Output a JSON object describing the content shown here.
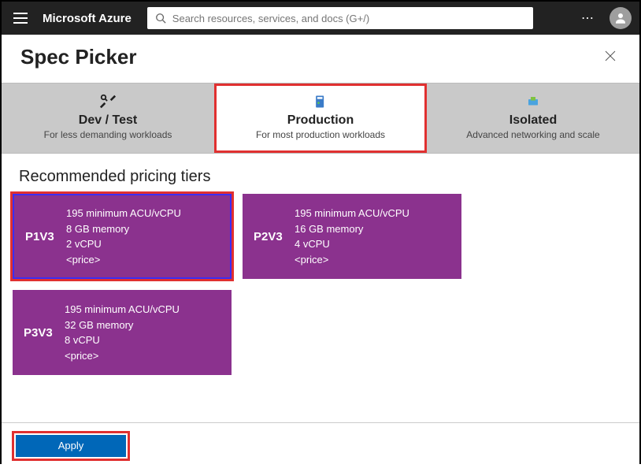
{
  "topbar": {
    "brand": "Microsoft Azure",
    "search_placeholder": "Search resources, services, and docs (G+/)"
  },
  "blade": {
    "title": "Spec Picker"
  },
  "tabs": [
    {
      "title": "Dev / Test",
      "subtitle": "For less demanding workloads",
      "active": false
    },
    {
      "title": "Production",
      "subtitle": "For most production workloads",
      "active": true
    },
    {
      "title": "Isolated",
      "subtitle": "Advanced networking and scale",
      "active": false
    }
  ],
  "section": {
    "recommended_label": "Recommended pricing tiers"
  },
  "tiers": [
    {
      "name": "P1V3",
      "acu": "195 minimum ACU/vCPU",
      "memory": "8 GB memory",
      "vcpu": "2 vCPU",
      "price": "<price>",
      "selected": true
    },
    {
      "name": "P2V3",
      "acu": "195 minimum ACU/vCPU",
      "memory": "16 GB memory",
      "vcpu": "4 vCPU",
      "price": "<price>",
      "selected": false
    },
    {
      "name": "P3V3",
      "acu": "195 minimum ACU/vCPU",
      "memory": "32 GB memory",
      "vcpu": "8 vCPU",
      "price": "<price>",
      "selected": false
    }
  ],
  "footer": {
    "apply_label": "Apply"
  }
}
